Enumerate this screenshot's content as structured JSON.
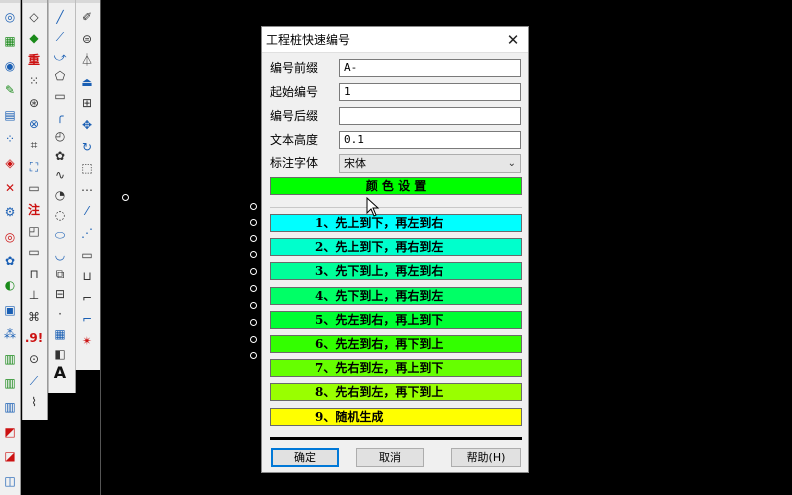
{
  "toolbar1": [
    {
      "glyph": "◎",
      "tone": "blue"
    },
    {
      "glyph": "▦",
      "tone": "green"
    },
    {
      "glyph": "◉",
      "tone": "blue"
    },
    {
      "glyph": "✎",
      "tone": "green"
    },
    {
      "glyph": "▤",
      "tone": "blue"
    },
    {
      "glyph": "⁘",
      "tone": "blue"
    },
    {
      "glyph": "◈",
      "tone": "red"
    },
    {
      "glyph": "✕",
      "tone": "red"
    },
    {
      "glyph": "⚙",
      "tone": "blue"
    },
    {
      "glyph": "◎",
      "tone": "red"
    },
    {
      "glyph": "✿",
      "tone": "blue"
    },
    {
      "glyph": "◐",
      "tone": "green"
    },
    {
      "glyph": "▣",
      "tone": "blue"
    },
    {
      "glyph": "⁂",
      "tone": "blue"
    },
    {
      "glyph": "▥",
      "tone": "green"
    },
    {
      "glyph": "▥",
      "tone": "green"
    },
    {
      "glyph": "▥",
      "tone": "blue"
    },
    {
      "glyph": "◩",
      "tone": "red"
    },
    {
      "glyph": "◪",
      "tone": "red"
    },
    {
      "glyph": "◫",
      "tone": "blue"
    }
  ],
  "toolbar2": [
    {
      "glyph": "◇",
      "tone": ""
    },
    {
      "glyph": "◆",
      "tone": "green"
    },
    {
      "glyph": "重",
      "tone": "red"
    },
    {
      "glyph": "⁙",
      "tone": ""
    },
    {
      "glyph": "⊛",
      "tone": ""
    },
    {
      "glyph": "⊗",
      "tone": "blue"
    },
    {
      "glyph": "⌗",
      "tone": ""
    },
    {
      "glyph": "⛶",
      "tone": "blue"
    },
    {
      "glyph": "▭",
      "tone": ""
    },
    {
      "glyph": "注",
      "tone": "red"
    },
    {
      "glyph": "◰",
      "tone": ""
    },
    {
      "glyph": "▭",
      "tone": ""
    },
    {
      "glyph": "⊓",
      "tone": ""
    },
    {
      "glyph": "⊥",
      "tone": ""
    },
    {
      "glyph": "⌘",
      "tone": ""
    },
    {
      "glyph": ".9!",
      "tone": "red"
    },
    {
      "glyph": "⊙",
      "tone": ""
    },
    {
      "glyph": "⟋",
      "tone": "blue"
    },
    {
      "glyph": "⌇",
      "tone": ""
    }
  ],
  "toolbar3": [
    {
      "glyph": "╱",
      "tone": "blue"
    },
    {
      "glyph": "⟋",
      "tone": "blue"
    },
    {
      "glyph": "⤻",
      "tone": "blue"
    },
    {
      "glyph": "⬠",
      "tone": ""
    },
    {
      "glyph": "▭",
      "tone": ""
    },
    {
      "glyph": "╭",
      "tone": "blue"
    },
    {
      "glyph": "◴",
      "tone": ""
    },
    {
      "glyph": "✿",
      "tone": ""
    },
    {
      "glyph": "∿",
      "tone": ""
    },
    {
      "glyph": "◔",
      "tone": ""
    },
    {
      "glyph": "◌",
      "tone": ""
    },
    {
      "glyph": "⬭",
      "tone": "blue"
    },
    {
      "glyph": "◡",
      "tone": "blue"
    },
    {
      "glyph": "⧉",
      "tone": ""
    },
    {
      "glyph": "⊟",
      "tone": ""
    },
    {
      "glyph": "·",
      "tone": ""
    },
    {
      "glyph": "▦",
      "tone": "blue"
    },
    {
      "glyph": "◧",
      "tone": ""
    },
    {
      "glyph": "A",
      "tone": "big"
    }
  ],
  "toolbar4": [
    {
      "glyph": "✐",
      "tone": ""
    },
    {
      "glyph": "⊜",
      "tone": ""
    },
    {
      "glyph": "⏃",
      "tone": ""
    },
    {
      "glyph": "⏏",
      "tone": "blue"
    },
    {
      "glyph": "⊞",
      "tone": ""
    },
    {
      "glyph": "✥",
      "tone": "blue"
    },
    {
      "glyph": "↻",
      "tone": "blue"
    },
    {
      "glyph": "⬚",
      "tone": ""
    },
    {
      "glyph": "⋯",
      "tone": ""
    },
    {
      "glyph": "⁄",
      "tone": "blue"
    },
    {
      "glyph": "⋰",
      "tone": "blue"
    },
    {
      "glyph": "▭",
      "tone": ""
    },
    {
      "glyph": "⊔",
      "tone": ""
    },
    {
      "glyph": "⌐",
      "tone": ""
    },
    {
      "glyph": "⌐",
      "tone": "blue"
    },
    {
      "glyph": "✴",
      "tone": "red"
    }
  ],
  "dialog": {
    "title": "工程桩快速编号",
    "close_glyph": "✕",
    "fields": {
      "prefix_label": "编号前缀",
      "prefix_value": "A-",
      "start_label": "起始编号",
      "start_value": "1",
      "suffix_label": "编号后缀",
      "suffix_value": "",
      "height_label": "文本高度",
      "height_value": "0.1",
      "font_label": "标注字体",
      "font_value": "宋体"
    },
    "color_button": {
      "label": "颜 色 设 置",
      "color": "#00ff00"
    },
    "options": [
      {
        "label": "1、先上到下，再左到右",
        "color": "#00ffff"
      },
      {
        "label": "2、先上到下，再右到左",
        "color": "#00ffcc"
      },
      {
        "label": "3、先下到上，再左到右",
        "color": "#00ff99"
      },
      {
        "label": "4、先下到上，再右到左",
        "color": "#00ff66"
      },
      {
        "label": "5、先左到右，再上到下",
        "color": "#00ff33"
      },
      {
        "label": "6、先左到右，再下到上",
        "color": "#33ff00"
      },
      {
        "label": "7、先右到左，再上到下",
        "color": "#66ff00"
      },
      {
        "label": "8、先右到左，再下到上",
        "color": "#99ff00"
      },
      {
        "label": "9、随机生成",
        "color": "#ffff00"
      }
    ],
    "buttons": {
      "ok": "确定",
      "cancel": "取消",
      "help": "帮助(H)"
    }
  }
}
